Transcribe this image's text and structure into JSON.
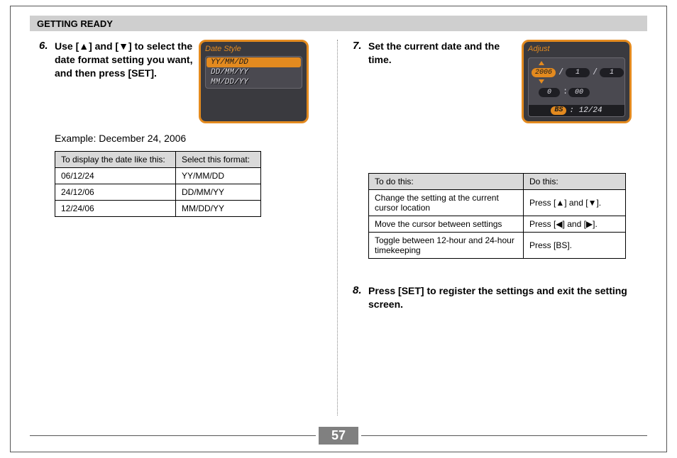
{
  "header": "GETTING READY",
  "page_number": "57",
  "glyphs": {
    "up": "▲",
    "down": "▼",
    "left": "◀",
    "right": "▶"
  },
  "step6": {
    "num": "6.",
    "text": "Use [▲] and [▼] to select the date format setting you want, and then press [SET].",
    "example_label": "Example: December 24, 2006",
    "table": {
      "headers": [
        "To display the date like this:",
        "Select this format:"
      ],
      "rows": [
        [
          "06/12/24",
          "YY/MM/DD"
        ],
        [
          "24/12/06",
          "DD/MM/YY"
        ],
        [
          "12/24/06",
          "MM/DD/YY"
        ]
      ]
    },
    "lcd": {
      "title": "Date Style",
      "options": [
        "YY/MM/DD",
        "DD/MM/YY",
        "MM/DD/YY"
      ],
      "selected_index": 0
    }
  },
  "step7": {
    "num": "7.",
    "text": "Set the current date and the time.",
    "table": {
      "headers": [
        "To do this:",
        "Do this:"
      ],
      "rows": [
        [
          "Change the setting at the current cursor location",
          "Press [▲] and [▼]."
        ],
        [
          "Move the cursor between settings",
          "Press [◀] and [▶]."
        ],
        [
          "Toggle between 12-hour and 24-hour timekeeping",
          "Press [BS]."
        ]
      ]
    },
    "lcd": {
      "title": "Adjust",
      "date_parts": {
        "year": "2006",
        "month": "1",
        "day": "1"
      },
      "time_parts": {
        "hour": "0",
        "minute": "00"
      },
      "footer_badge": "BS",
      "footer_text": ": 12/24"
    }
  },
  "step8": {
    "num": "8.",
    "text": "Press [SET] to register the settings and exit the setting screen."
  }
}
